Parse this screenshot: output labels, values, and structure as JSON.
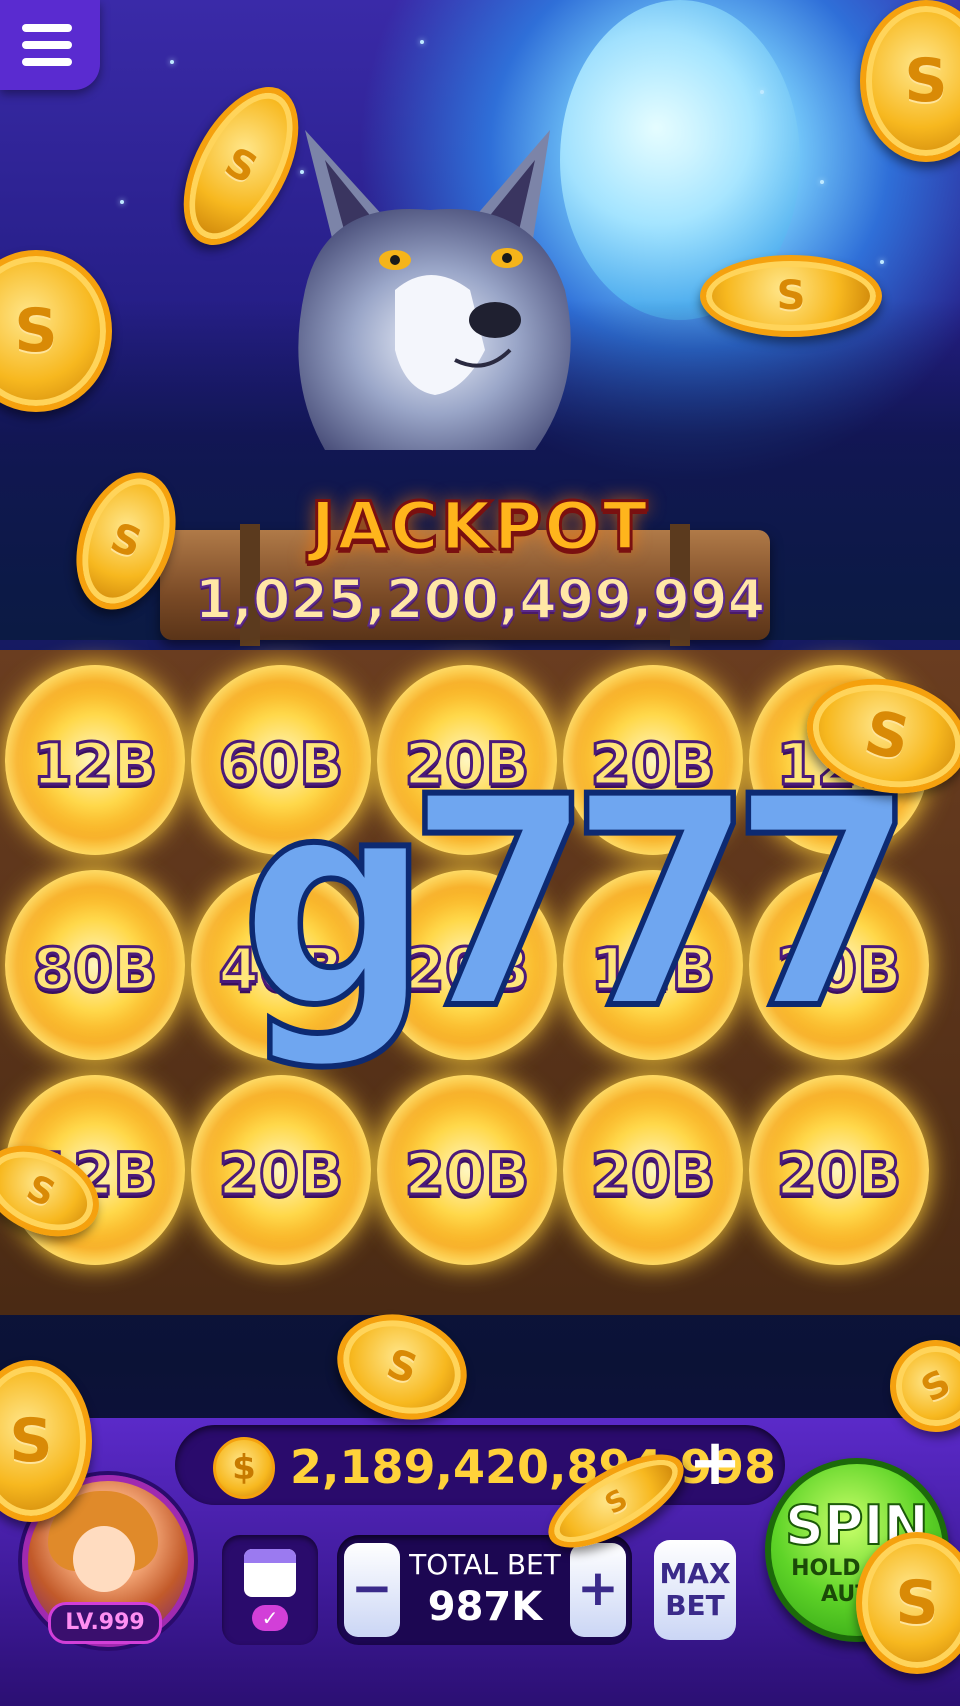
{
  "game": {
    "jackpot_title": "JACKPOT",
    "jackpot_value": "1,025,200,499,994",
    "overlay_text": "g777"
  },
  "reels": [
    [
      "12B",
      "60B",
      "20B",
      "20B",
      "12B"
    ],
    [
      "80B",
      "40B",
      "20B",
      "12B",
      "20B"
    ],
    [
      "12B",
      "20B",
      "20B",
      "20B",
      "20B"
    ]
  ],
  "footer": {
    "balance": "2,189,420,894,998",
    "level": "LV.999",
    "total_bet_label": "TOTAL BET",
    "total_bet_value": "987K",
    "minus": "−",
    "plus": "+",
    "max_bet": "MAX BET",
    "spin": "SPIN",
    "spin_sub": "HOLD FOR AUTO"
  },
  "icons": {
    "menu": "hamburger-menu-icon",
    "coin": "dollar-coin-icon",
    "calendar": "daily-calendar-icon"
  },
  "colors": {
    "accent": "#5a2bd0",
    "gold": "#ffd23a",
    "spin_green": "#5fd428"
  }
}
